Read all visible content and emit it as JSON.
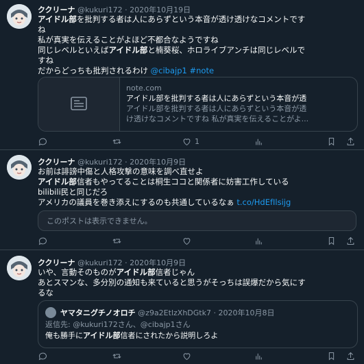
{
  "tweets": [
    {
      "name": "ククリーナ",
      "handle": "@kukuri172",
      "sep": "·",
      "date": "2020年10月19日",
      "lines": [
        {
          "b": "アイドル部",
          "t": "を批判する者は人にあらずという本音が透け透けなコメントです"
        },
        {
          "b": "",
          "t": "ね"
        },
        {
          "b": "",
          "t": "私が真実を伝えることがよほど不都合なようですね"
        },
        {
          "t1": "同じレベルといえば",
          "b": "アイドル部",
          "t2": "と楠葵桜、ホロライブアンチは同じレベルで"
        },
        {
          "b": "",
          "t": "すね"
        }
      ],
      "last_line": {
        "t": "だからどっちも批判されるわけ",
        "link1": "@cibajp1",
        "link2": "#note"
      },
      "card": {
        "domain": "note.com",
        "title": "アイドル部を批判する者は人にあらずという本音が透",
        "desc1": "アイドル部を批判する者は人にあらずという本音が透",
        "desc2": "け透けなコメントですね 私が真実を伝えることがよ..."
      },
      "actions": {
        "like_count": "1"
      }
    },
    {
      "name": "ククリーナ",
      "handle": "@kukuri172",
      "sep": "·",
      "date": "2020年10月9日",
      "line1": "お前は誹謗中傷と人格攻撃の意味を調べ直せよ",
      "line2_b": "アイドル部",
      "line2_t": "信者もやってることは桐生ココと関係者に妨害工作している",
      "line3": "bilibili民と同じだろ",
      "line4": "アメリカの議員を巻き添えにするのも共通しているなぁ",
      "line4_link": "t.co/HdEfIlsijg",
      "unavailable": "このポストは表示できません。"
    },
    {
      "name": "ククリーナ",
      "handle": "@kukuri172",
      "sep": "·",
      "date": "2020年10月9日",
      "line1_t": "いや、言動そのものが",
      "line1_b": "アイドル部",
      "line1_t2": "信者じゃん",
      "line2": "あとスマンな、多分別の通知も来ていると思うがそっちは誤爆だから気にす",
      "line3": "るな",
      "quote": {
        "name": "ヤマタニグチノオロチ",
        "handle": "@z9a2EtlzXhDGtk7",
        "sep": "·",
        "date": "2020年10月8日",
        "reply_to": "返信先: @kukuri172さん、@cibajp1さん",
        "text_t": "俺も勝手に",
        "text_b": "アイドル部",
        "text_t2": "信者にされたから説明しろよ"
      }
    }
  ]
}
